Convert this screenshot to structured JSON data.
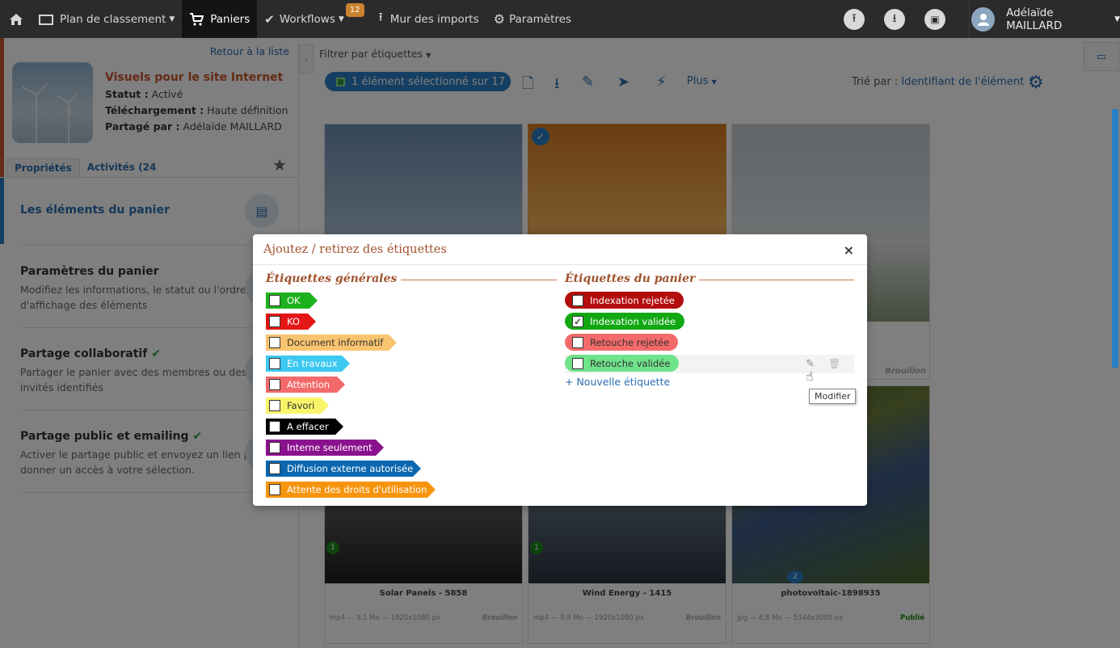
{
  "topbar": {
    "nav": [
      {
        "label": "Plan de classement",
        "has_caret": true
      },
      {
        "label": "Paniers",
        "active": true
      },
      {
        "label": "Workflows",
        "has_caret": true,
        "badge": "12"
      },
      {
        "label": "Mur des imports"
      },
      {
        "label": "Paramètres"
      }
    ],
    "user_name": "Adélaïde MAILLARD"
  },
  "left": {
    "back_link": "Retour à la liste",
    "basket_title": "Visuels pour le site Internet",
    "status_label": "Statut :",
    "status_value": "Activé",
    "download_label": "Téléchargement :",
    "download_value": "Haute définition",
    "shared_label": "Partagé par :",
    "shared_value": "Adélaïde MAILLARD",
    "tab_properties": "Propriétés",
    "tab_activities": "Activités (24",
    "sections": [
      {
        "title": "Les éléments du panier",
        "desc": ""
      },
      {
        "title": "Paramètres du panier",
        "desc": "Modifiez les informations, le statut ou l'ordre d'affichage des éléments"
      },
      {
        "title": "Partage collaboratif",
        "desc": "Partager le panier avec des membres ou des invités identifiés"
      },
      {
        "title": "Partage public et emailing",
        "desc": "Activer le partage public et envoyez un lien pour donner un accès à votre sélection."
      }
    ]
  },
  "main": {
    "filter": "Filtrer par étiquettes",
    "selection": "1 élément sélectionné sur 17",
    "more": "Plus",
    "sort_label": "Trié par :",
    "sort_value": "Identifiant de l'élément ↑",
    "cards": [
      {
        "caption": "Solar Panels - 5858",
        "meta": "mp4 — 9,1 Mo — 1920x1080 px",
        "status": "Brouillon"
      },
      {
        "caption": "Wind Energy - 1415",
        "meta": "mp4 — 9,8 Mo — 1920x1080 px",
        "status": "Brouillon"
      },
      {
        "caption": "photovoltaic-1898935",
        "meta": "jpg — 8,8 Mo — 5344x3008 px",
        "status": "Publié"
      }
    ],
    "card_status_top": "Brouillon",
    "badges": [
      "1",
      "1",
      "2"
    ]
  },
  "modal": {
    "title": "Ajoutez / retirez des étiquettes",
    "close": "×",
    "general_title": "Étiquettes générales",
    "basket_title": "Étiquettes du panier",
    "general_tags": [
      {
        "label": "OK",
        "color": "#1db21d",
        "text_color": "#fff"
      },
      {
        "label": "KO",
        "color": "#e41616",
        "text_color": "#fff"
      },
      {
        "label": "Document informatif",
        "color": "#f9c46f",
        "text_color": "#333"
      },
      {
        "label": "En travaux",
        "color": "#3cc8f0",
        "text_color": "#fff"
      },
      {
        "label": "Attention",
        "color": "#f46a6a",
        "text_color": "#fff"
      },
      {
        "label": "Favori",
        "color": "#f9f56a",
        "text_color": "#333"
      },
      {
        "label": "A effacer",
        "color": "#000000",
        "text_color": "#fff"
      },
      {
        "label": "Interne seulement",
        "color": "#8b128e",
        "text_color": "#fff"
      },
      {
        "label": "Diffusion externe autorisée",
        "color": "#0b68b0",
        "text_color": "#fff"
      },
      {
        "label": "Attente des droits d'utilisation",
        "color": "#f7940e",
        "text_color": "#fff"
      }
    ],
    "basket_tags": [
      {
        "label": "Indexation rejetée",
        "color": "#b40d0d",
        "text_color": "#fff",
        "checked": false
      },
      {
        "label": "Indexation validée",
        "color": "#12a812",
        "text_color": "#fff",
        "checked": true
      },
      {
        "label": "Retouche rejetée",
        "color": "#f46a6a",
        "text_color": "#333",
        "checked": false
      },
      {
        "label": "Retouche validée",
        "color": "#6fe38a",
        "text_color": "#333",
        "checked": false
      }
    ],
    "new_tag": "+ Nouvelle étiquette",
    "tooltip": "Modifier"
  }
}
